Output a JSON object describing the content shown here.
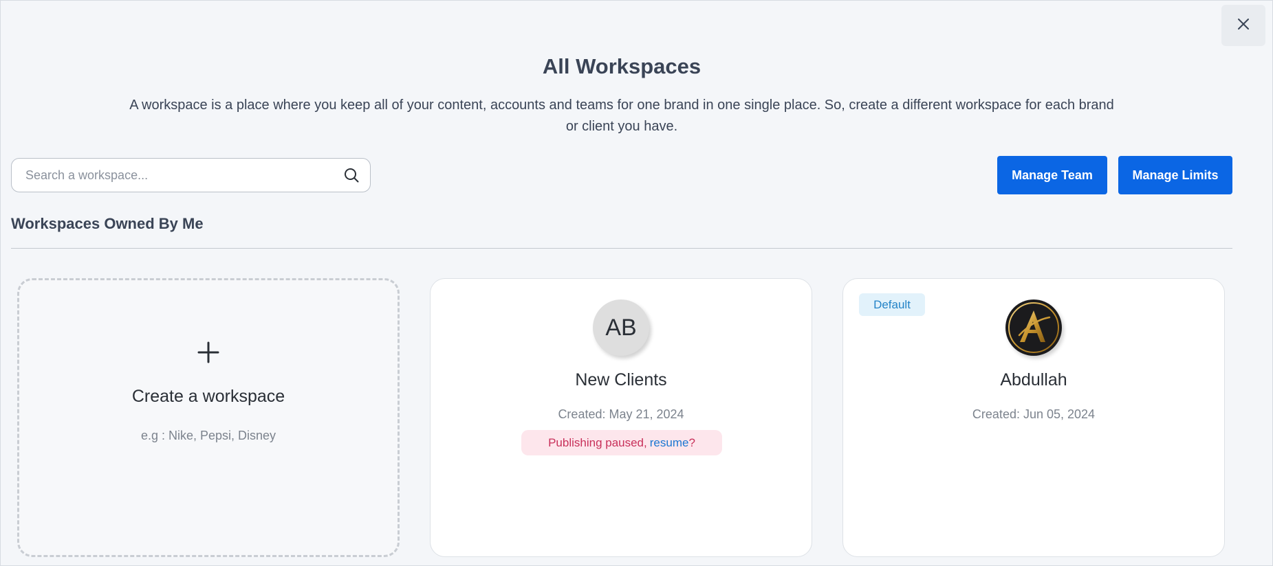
{
  "header": {
    "title": "All Workspaces",
    "description": "A workspace is a place where you keep all of your content, accounts and teams for one brand in one single place. So, create a different workspace for each brand or client you have.",
    "close_icon": "close-icon"
  },
  "search": {
    "placeholder": "Search a workspace...",
    "value": "",
    "icon": "search-icon"
  },
  "actions": {
    "manage_team_label": "Manage Team",
    "manage_limits_label": "Manage Limits"
  },
  "section": {
    "title": "Workspaces Owned By Me"
  },
  "create_card": {
    "icon": "plus-icon",
    "title": "Create a workspace",
    "hint": "e.g : Nike, Pepsi, Disney"
  },
  "workspaces": [
    {
      "initials": "AB",
      "name": "New Clients",
      "created": "Created: May 21, 2024",
      "status_text": "Publishing paused,",
      "status_link": "resume",
      "status_suffix": "?"
    },
    {
      "badge": "Default",
      "logo_icon": "letter-a-logo-icon",
      "logo_letter": "A",
      "name": "Abdullah",
      "created": "Created: Jun 05, 2024"
    }
  ],
  "colors": {
    "primary": "#0b66e4",
    "background": "#f4f6f9",
    "text": "#3a4456",
    "paused_bg": "#fde6ec",
    "paused_text": "#c8305a",
    "link": "#1b77d2",
    "badge_bg": "#e2f2fb",
    "badge_text": "#2383c7"
  }
}
